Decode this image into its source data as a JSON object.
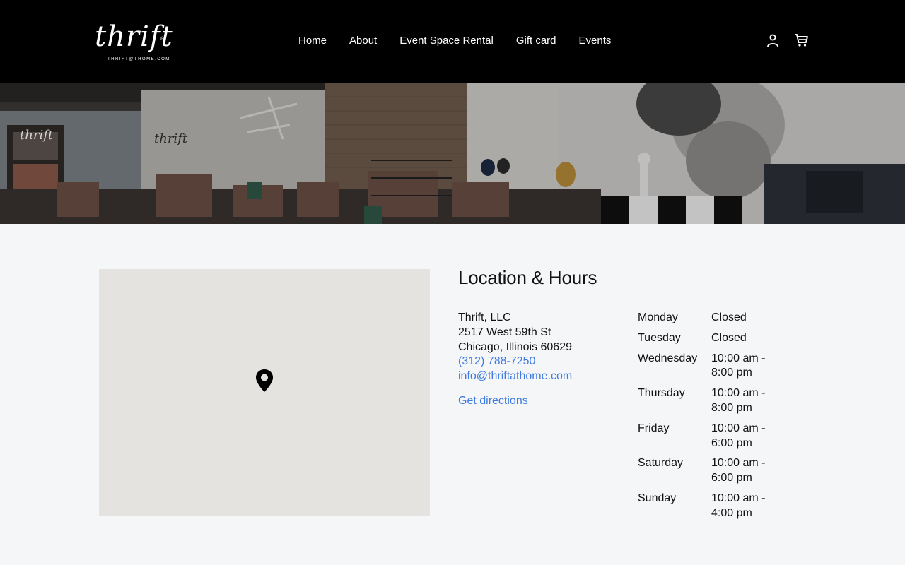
{
  "brand": {
    "logo_script": "thrift",
    "logo_subtext": "THRIFT@THOME.COM",
    "logo_mark": "®"
  },
  "nav": {
    "items": [
      {
        "label": "Home"
      },
      {
        "label": "About"
      },
      {
        "label": "Event Space Rental"
      },
      {
        "label": "Gift card"
      },
      {
        "label": "Events"
      }
    ]
  },
  "header_icons": {
    "account": "account-icon",
    "cart": "cart-icon"
  },
  "hero": {
    "image": "store-interior-photo"
  },
  "map": {
    "pin": "map-pin-icon"
  },
  "location": {
    "title": "Location & Hours",
    "business_name": "Thrift, LLC",
    "street": "2517 West 59th St",
    "city_line": "Chicago, Illinois 60629",
    "phone": "(312) 788-7250",
    "email": "info@thriftathome.com",
    "directions_label": "Get directions"
  },
  "hours": [
    {
      "day": "Monday",
      "time": "Closed"
    },
    {
      "day": "Tuesday",
      "time": "Closed"
    },
    {
      "day": "Wednesday",
      "time": "10:00 am - 8:00 pm"
    },
    {
      "day": "Thursday",
      "time": "10:00 am - 8:00 pm"
    },
    {
      "day": "Friday",
      "time": "10:00 am - 6:00 pm"
    },
    {
      "day": "Saturday",
      "time": "10:00 am - 6:00 pm"
    },
    {
      "day": "Sunday",
      "time": "10:00 am - 4:00 pm"
    }
  ],
  "colors": {
    "header_bg": "#000000",
    "page_bg": "#f4f6f8",
    "link": "#3f7be0",
    "map_bg": "#e5e3df"
  }
}
